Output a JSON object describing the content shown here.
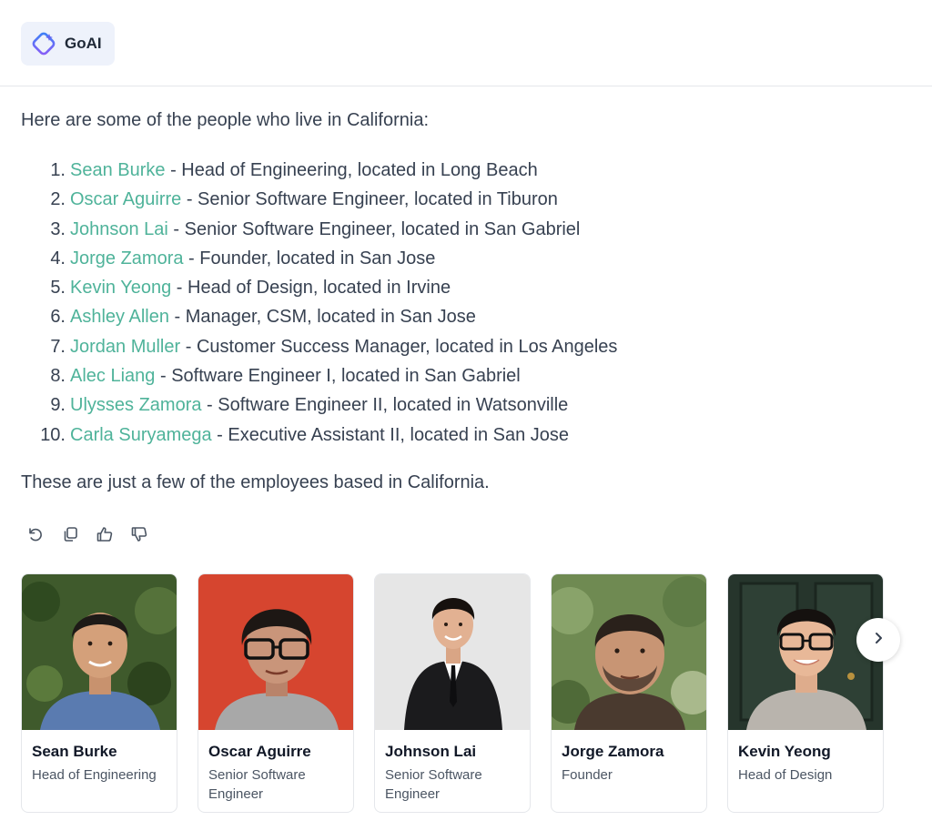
{
  "app": {
    "name": "GoAI"
  },
  "message": {
    "intro": "Here are some of the people who live in California:",
    "people": [
      {
        "number": "1.",
        "name": "Sean Burke",
        "detail": "Head of Engineering, located in Long Beach"
      },
      {
        "number": "2.",
        "name": "Oscar Aguirre",
        "detail": "Senior Software Engineer, located in Tiburon"
      },
      {
        "number": "3.",
        "name": "Johnson Lai",
        "detail": "Senior Software Engineer, located in San Gabriel"
      },
      {
        "number": "4.",
        "name": "Jorge Zamora",
        "detail": "Founder, located in San Jose"
      },
      {
        "number": "5.",
        "name": "Kevin Yeong",
        "detail": "Head of Design, located in Irvine"
      },
      {
        "number": "6.",
        "name": "Ashley Allen",
        "detail": "Manager, CSM, located in San Jose"
      },
      {
        "number": "7.",
        "name": "Jordan Muller",
        "detail": "Customer Success Manager, located in Los Angeles"
      },
      {
        "number": "8.",
        "name": "Alec Liang",
        "detail": "Software Engineer I, located in San Gabriel"
      },
      {
        "number": "9.",
        "name": "Ulysses Zamora",
        "detail": "Software Engineer II, located in Watsonville"
      },
      {
        "number": "10.",
        "name": "Carla Suryamega",
        "detail": "Executive Assistant II, located in San Jose"
      }
    ],
    "separator": " - ",
    "outro": "These are just a few of the employees based in California."
  },
  "actions": [
    "refresh-icon",
    "copy-icon",
    "thumbs-up-icon",
    "thumbs-down-icon"
  ],
  "cards": [
    {
      "name": "Sean Burke",
      "role": "Head of Engineering"
    },
    {
      "name": "Oscar Aguirre",
      "role": "Senior Software Engineer"
    },
    {
      "name": "Johnson Lai",
      "role": "Senior Software Engineer"
    },
    {
      "name": "Jorge Zamora",
      "role": "Founder"
    },
    {
      "name": "Kevin Yeong",
      "role": "Head of Design"
    }
  ],
  "colors": {
    "link": "#4fb39a",
    "brand_bg": "#eef2fb",
    "text": "#374151"
  }
}
